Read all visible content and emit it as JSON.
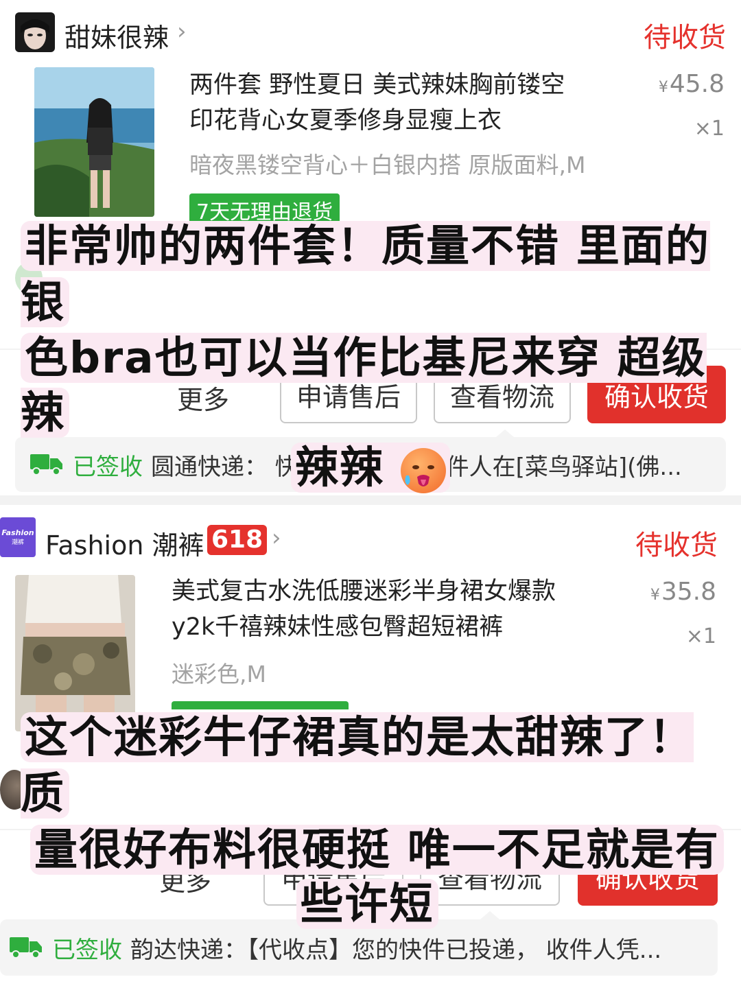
{
  "orders": [
    {
      "shop_name": "甜妹很辣",
      "status": "待收货",
      "title_line1": "两件套 野性夏日 美式辣妹胸前镂空",
      "title_line2": "印花背心女夏季修身显瘦上衣",
      "price_symbol": "¥",
      "price": "45.8",
      "qty": "×1",
      "spec": "暗夜黑镂空背心＋白银内搭 原版面料,M",
      "tag": "7天无理由退货",
      "more_label": "更多",
      "after_sale_label": "申请售后",
      "logistics_button_label": "查看物流",
      "confirm_label": "确认收货",
      "logistics_status": "已签收",
      "logistics_text": "圆通快递： 快件已领取， 收件人在[菜鸟驿站](佛..."
    },
    {
      "shop_name": "Fashion 潮裤",
      "shop_logo_text": "Fashion",
      "shop_logo_sub": "潮裤",
      "badge": "618",
      "status": "待收货",
      "title_line1": "美式复古水洗低腰迷彩半身裙女爆款",
      "title_line2": "y2k千禧辣妹性感包臀超短裙裤",
      "price_symbol": "¥",
      "price": "35.8",
      "qty": "×1",
      "spec": "迷彩色,M",
      "more_label": "更多",
      "after_sale_label": "申请售后",
      "logistics_button_label": "查看物流",
      "confirm_label": "确认收货",
      "logistics_status": "已签收",
      "logistics_text": "韵达快递：【代收点】您的快件已投递， 收件人凭..."
    }
  ],
  "captions": {
    "caption1_line1": "非常帅的两件套！质量不错 里面的银",
    "caption1_line2": "色bra也可以当作比基尼来穿 超级辣",
    "caption1_line3": "辣辣",
    "caption2_line1": "这个迷彩牛仔裙真的是太甜辣了！质",
    "caption2_line2": "量很好布料很硬挺 唯一不足就是有",
    "caption2_line3": "些许短"
  },
  "colors": {
    "accent_red": "#e1312c",
    "green": "#2fae3e",
    "caption_highlight": "#fbe9f2"
  }
}
